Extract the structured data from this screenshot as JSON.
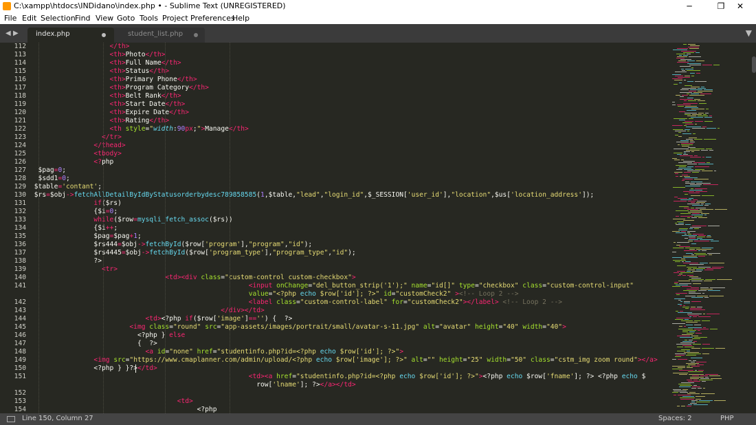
{
  "window": {
    "title": "C:\\xampp\\htdocs\\INDidano\\index.php • - Sublime Text (UNREGISTERED)",
    "minimize": "─",
    "maximize": "❐",
    "close": "✕"
  },
  "menu": [
    "File",
    "Edit",
    "Selection",
    "Find",
    "View",
    "Goto",
    "Tools",
    "Project",
    "Preferences",
    "Help"
  ],
  "tabs": [
    {
      "label": "index.php",
      "active": true,
      "dirty": true
    },
    {
      "label": "student_list.php",
      "active": false,
      "dirty": true
    }
  ],
  "nav": {
    "back": "◀",
    "forward": "▶",
    "overflow": "▼"
  },
  "code_lines": [
    {
      "n": "112",
      "indent": "                    ",
      "html": "<span class=t>&lt;/th&gt;</span>"
    },
    {
      "n": "113",
      "indent": "                    ",
      "html": "<span class=t>&lt;th&gt;</span>Photo<span class=t>&lt;/th&gt;</span>"
    },
    {
      "n": "114",
      "indent": "                    ",
      "html": "<span class=t>&lt;th&gt;</span>Full Name<span class=t>&lt;/th&gt;</span>"
    },
    {
      "n": "115",
      "indent": "                    ",
      "html": "<span class=t>&lt;th&gt;</span>Status<span class=t>&lt;/th&gt;</span>"
    },
    {
      "n": "116",
      "indent": "                    ",
      "html": "<span class=t>&lt;th&gt;</span>Primary Phone<span class=t>&lt;/th&gt;</span>"
    },
    {
      "n": "117",
      "indent": "                    ",
      "html": "<span class=t>&lt;th&gt;</span>Program Category<span class=t>&lt;/th&gt;</span>"
    },
    {
      "n": "118",
      "indent": "                    ",
      "html": "<span class=t>&lt;th&gt;</span>Belt Rank<span class=t>&lt;/th&gt;</span>"
    },
    {
      "n": "119",
      "indent": "                    ",
      "html": "<span class=t>&lt;th&gt;</span>Start Date<span class=t>&lt;/th&gt;</span>"
    },
    {
      "n": "120",
      "indent": "                    ",
      "html": "<span class=t>&lt;th&gt;</span>Expire Date<span class=t>&lt;/th&gt;</span>"
    },
    {
      "n": "121",
      "indent": "                    ",
      "html": "<span class=t>&lt;th&gt;</span>Rating<span class=t>&lt;/th&gt;</span>"
    },
    {
      "n": "122",
      "indent": "                    ",
      "html": "<span class=t>&lt;th </span><span class=a>style</span>=<span class=s>\"</span><span class=i>width</span>:<span class=n>90</span><span class=k>px</span>;<span class=s>\"</span><span class=t>&gt;</span>Manage<span class=t>&lt;/th&gt;</span>"
    },
    {
      "n": "123",
      "indent": "                  ",
      "html": "<span class=t>&lt;/tr&gt;</span>"
    },
    {
      "n": "124",
      "indent": "                ",
      "html": "<span class=t>&lt;/thead&gt;</span>"
    },
    {
      "n": "125",
      "indent": "                ",
      "html": "<span class=t>&lt;tbody&gt;</span>"
    },
    {
      "n": "126",
      "indent": "                ",
      "html": "<span class=t>&lt;?</span>php"
    },
    {
      "n": "127",
      "indent": "  ",
      "html": "$pag<span class=k>=</span><span class=n>0</span>;"
    },
    {
      "n": "128",
      "indent": "  ",
      "html": "$sdd1<span class=k>=</span><span class=n>0</span>;"
    },
    {
      "n": "129",
      "indent": " ",
      "html": "$table<span class=k>=</span><span class=s>'contant'</span>;"
    },
    {
      "n": "130",
      "indent": " ",
      "html": "$rs<span class=k>=</span>$obj<span class=k>-&gt;</span><span class=f>fetchAllDetailByIdByStatusorderbydesc789858585</span>(<span class=n>1</span>,$table,<span class=s>\"lead\"</span>,<span class=s>\"login_id\"</span>,$_SESSION[<span class=s>'user_id'</span>],<span class=s>\"location\"</span>,$us[<span class=s>'location_address'</span>]);"
    },
    {
      "n": "131",
      "indent": "                ",
      "html": "<span class=k>if</span>($rs)"
    },
    {
      "n": "132",
      "indent": "                ",
      "html": "{$i<span class=k>=</span><span class=n>0</span>;"
    },
    {
      "n": "133",
      "indent": "                ",
      "html": "<span class=k>while</span>($row<span class=k>=</span><span class=f>mysqli_fetch_assoc</span>($rs))"
    },
    {
      "n": "134",
      "indent": "                ",
      "html": "{$i<span class=k>++</span>;"
    },
    {
      "n": "135",
      "indent": "                ",
      "html": "$pag<span class=k>=</span>$pag<span class=k>+</span><span class=n>1</span>;"
    },
    {
      "n": "136",
      "indent": "                ",
      "html": "$rs444<span class=k>=</span>$obj<span class=k>-&gt;</span><span class=f>fetchById</span>($row[<span class=s>'program'</span>],<span class=s>\"program\"</span>,<span class=s>\"id\"</span>);"
    },
    {
      "n": "137",
      "indent": "                ",
      "html": "$rs4445<span class=k>=</span>$obj<span class=k>-&gt;</span><span class=f>fetchById</span>($row[<span class=s>'program_type'</span>],<span class=s>\"program_type\"</span>,<span class=s>\"id\"</span>);"
    },
    {
      "n": "138",
      "indent": "                ",
      "html": "?&gt;"
    },
    {
      "n": "139",
      "indent": "                  ",
      "html": "<span class=t>&lt;tr&gt;</span>"
    },
    {
      "n": "140",
      "indent": "                                  ",
      "html": "<span class=t>&lt;td&gt;&lt;div </span><span class=a>class</span>=<span class=s>\"custom-control custom-checkbox\"</span><span class=t>&gt;</span>"
    },
    {
      "n": "141",
      "indent": "                                                       ",
      "html": "<span class=t>&lt;input </span><span class=a>onChange</span>=<span class=s>\"del_button_strip('1');\"</span> <span class=a>name</span>=<span class=s>\"id[]\"</span> <span class=a>type</span>=<span class=s>\"checkbox\"</span> <span class=a>class</span>=<span class=s>\"custom-control-input\"</span>"
    },
    {
      "n": "",
      "indent": "                                                       ",
      "html": "<span class=a>value</span>=<span class=s>\"&lt;?php </span><span class=f>echo</span><span class=s> $row['id']; ?&gt;\"</span> <span class=a>id</span>=<span class=s>\"customCheck2\"</span> <span class=t>&gt;</span><span class=c>&lt;!-- Loop 2 --&gt;</span>"
    },
    {
      "n": "142",
      "indent": "                                                       ",
      "html": "<span class=t>&lt;label </span><span class=a>class</span>=<span class=s>\"custom-control-label\"</span> <span class=a>for</span>=<span class=s>\"customCheck2\"</span><span class=t>&gt;&lt;/label&gt;</span> <span class=c>&lt;!-- Loop 2 --&gt;</span>"
    },
    {
      "n": "143",
      "indent": "                                                ",
      "html": "<span class=t>&lt;/div&gt;&lt;/td&gt;</span>"
    },
    {
      "n": "144",
      "indent": "                             ",
      "html": "<span class=t>&lt;td&gt;</span>&lt;?php <span class=k>if</span>($row[<span class=s>'image'</span>]<span class=k>==</span><span class=s>''</span>) {  ?&gt;"
    },
    {
      "n": "145",
      "indent": "                         ",
      "html": "<span class=t>&lt;img </span><span class=a>class</span>=<span class=s>\"round\"</span> <span class=a>src</span>=<span class=s>\"app-assets/images/portrait/small/avatar-s-11.jpg\"</span> <span class=a>alt</span>=<span class=s>\"avatar\"</span> <span class=a>height</span>=<span class=s>\"40\"</span> <span class=a>width</span>=<span class=s>\"40\"</span><span class=t>&gt;</span>"
    },
    {
      "n": "146",
      "indent": "                           ",
      "html": "&lt;?php } <span class=k>else</span>"
    },
    {
      "n": "147",
      "indent": "                           ",
      "html": "{  ?&gt;"
    },
    {
      "n": "148",
      "indent": "                             ",
      "html": "<span class=t>&lt;a </span><span class=a>id</span>=<span class=s>\"none\"</span> <span class=a>href</span>=<span class=s>\"studentinfo.php?id=&lt;?php </span><span class=f>echo</span><span class=s> $row['id']; ?&gt;\"</span><span class=t>&gt;</span>"
    },
    {
      "n": "149",
      "indent": "                ",
      "html": "<span class=t>&lt;img </span><span class=a>src</span>=<span class=s>\"https://www.cmaplanner.com/admin/upload/&lt;?php </span><span class=f>echo</span><span class=s> $row['image']; ?&gt;\"</span> <span class=a>alt</span>=<span class=s>\"\"</span> <span class=a>height</span>=<span class=s>\"25\"</span> <span class=a>width</span>=<span class=s>\"50\"</span> <span class=a>class</span>=<span class=s>\"cstm_img zoom round\"</span><span class=t>&gt;&lt;/a&gt;</span>"
    },
    {
      "n": "150",
      "indent": "                ",
      "html": "&lt;?php } }?&gt;<span class=t>&lt;/td&gt;</span>"
    },
    {
      "n": "151",
      "indent": "                                                       ",
      "html": "<span class=t>&lt;td&gt;&lt;a </span><span class=a>href</span>=<span class=s>\"studentinfo.php?id=&lt;?php </span><span class=f>echo</span><span class=s> $row['id']; ?&gt;\"</span><span class=t>&gt;</span>&lt;?php <span class=f>echo</span> $row[<span class=s>'fname'</span>]; ?&gt; &lt;?php <span class=f>echo</span> $"
    },
    {
      "n": "",
      "indent": "                                                         ",
      "html": "row[<span class=s>'lname'</span>]; ?&gt;<span class=t>&lt;/a&gt;&lt;/td&gt;</span>"
    },
    {
      "n": "152",
      "indent": "",
      "html": ""
    },
    {
      "n": "153",
      "indent": "                                     ",
      "html": "<span class=t>&lt;td&gt;</span>"
    },
    {
      "n": "154",
      "indent": "                                          ",
      "html": "&lt;?php"
    }
  ],
  "status": {
    "position": "Line 150, Column 27",
    "spaces": "Spaces: 2",
    "syntax": "PHP"
  },
  "colors": {
    "background": "#272822",
    "tag": "#f92672",
    "attribute": "#a6e22e",
    "string": "#e6db74",
    "number": "#ae81ff",
    "comment": "#75715e",
    "function": "#66d9ef"
  }
}
